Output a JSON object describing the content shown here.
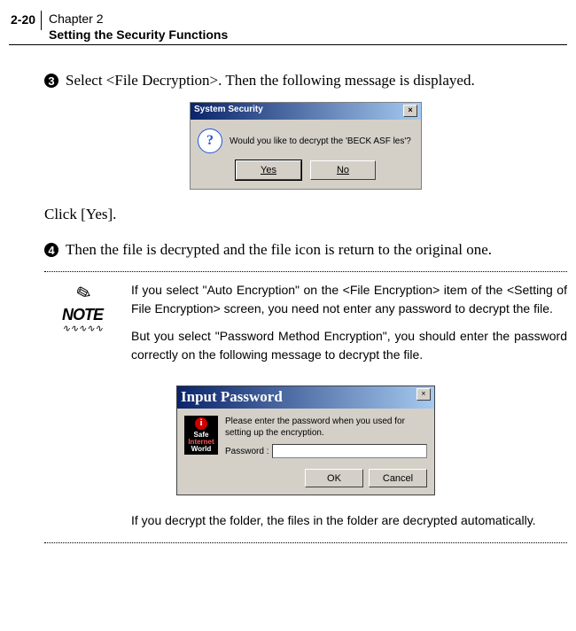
{
  "header": {
    "page_number": "2-20",
    "chapter": "Chapter 2",
    "section": "Setting the Security Functions"
  },
  "steps": {
    "s3_num": "3",
    "s3_text": "Select <File Decryption>. Then the following message is displayed.",
    "click_line": "Click [Yes].",
    "s4_num": "4",
    "s4_text": "Then the file is decrypted and the file icon is return to the original one."
  },
  "dialog1": {
    "title": "System Security",
    "close_glyph": "×",
    "question_glyph": "?",
    "message": "Would you like to decrypt the 'BECK ASF les'?",
    "yes": "Yes",
    "no": "No"
  },
  "note": {
    "icon_pencil": "✎",
    "icon_label": "NOTE",
    "icon_wave": "∿∿∿∿∿",
    "para1": "If you select \"Auto Encryption\" on the <File Encryption> item of the <Setting of File Encryption> screen, you need not enter any password to decrypt the file.",
    "para2": "But you select \"Password Method Encryption\", you should enter the password correctly on the following message to decrypt the file.",
    "final": "If you decrypt the folder, the files in the folder are decrypted automatically."
  },
  "dialog2": {
    "title": "Input Password",
    "close_glyph": "×",
    "safe_warn": "i",
    "safe_line1": "Safe",
    "safe_line2": "Internet",
    "safe_line3": "World",
    "message": "Please enter the password when you used for setting up the encryption.",
    "pwd_label": "Password :",
    "ok": "OK",
    "cancel": "Cancel"
  }
}
